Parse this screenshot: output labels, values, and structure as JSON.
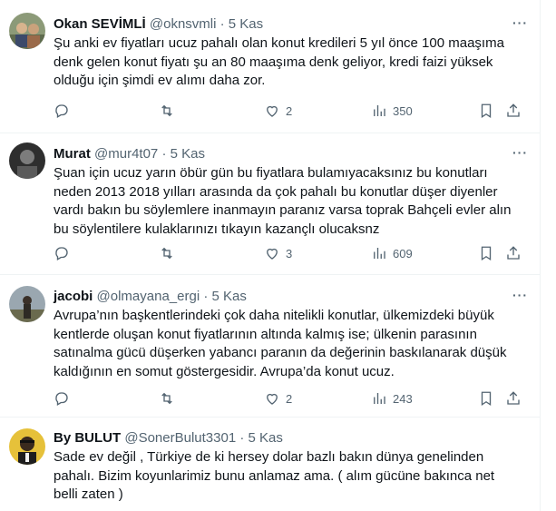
{
  "tweets": [
    {
      "name": "Okan SEVİMLİ",
      "handle": "@oknsvmli",
      "dot": "·",
      "time": "5 Kas",
      "text": "Şu anki ev fiyatları ucuz pahalı olan konut kredileri 5 yıl önce 100 maaşıma\ndenk gelen konut fiyatı şu an 80 maaşıma denk geliyor, kredi faizi yüksek\nolduğu için şimdi ev alımı daha zor.",
      "replies": "",
      "retweets": "",
      "likes": "2",
      "views": "350",
      "avatar_colors": [
        "#7a8b6a",
        "#c9b48a"
      ]
    },
    {
      "name": "Murat",
      "handle": "@mur4t07",
      "dot": "·",
      "time": "5 Kas",
      "text": "Şuan için ucuz yarın öbür  gün bu fiyatlara bulamıyacaksınız bu konutları\nneden 2013 2018 yılları arasında da çok pahalı bu konutlar düşer diyenler\nvardı bakın bu söylemlere inanmayın paranız varsa toprak Bahçeli evler alın\nbu söylentilere kulaklarınızı tıkayın kazançlı olucaksnz",
      "replies": "",
      "retweets": "",
      "likes": "3",
      "views": "609",
      "avatar_colors": [
        "#3a3a3a",
        "#8a8a8a"
      ]
    },
    {
      "name": "jacobi",
      "handle": "@olmayana_ergi",
      "dot": "·",
      "time": "5 Kas",
      "text": "Avrupa’nın başkentlerindeki çok daha nitelikli konutlar, ülkemizdeki büyük\nkentlerde oluşan konut fiyatlarının altında kalmış ise; ülkenin parasının\nsatınalma gücü düşerken yabancı paranın da  değerinin baskılanarak düşük\nkaldığının en somut göstergesidir. Avrupa’da konut ucuz.",
      "replies": "",
      "retweets": "",
      "likes": "2",
      "views": "243",
      "avatar_colors": [
        "#7e8f9e",
        "#4a4a3a"
      ]
    },
    {
      "name": "By BULUT",
      "handle": "@SonerBulut3301",
      "dot": "·",
      "time": "5 Kas",
      "text": "Sade ev değil , Türkiye de ki hersey dolar bazlı bakın dünya genelinden\npahalı.   Bizim koyunlarimiz bunu anlamaz ama.  ( alım gücüne bakınca net\nbelli zaten )",
      "avatar_colors": [
        "#e8c23a",
        "#2a2a2a"
      ]
    }
  ]
}
